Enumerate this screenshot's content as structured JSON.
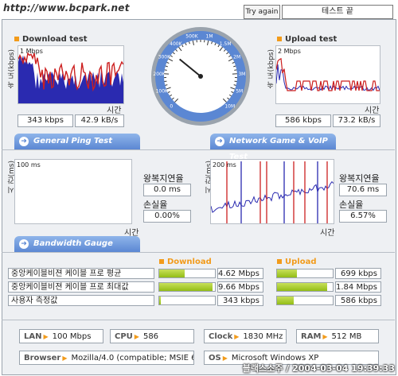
{
  "watermark_url": "http://www.bcpark.net",
  "header": {
    "try_again": "Try again",
    "test_end": "테스트 끝"
  },
  "download": {
    "title": "Download test",
    "ylabel": "속 도(kbps)",
    "scale": "1 Mbps",
    "xlabel": "시간",
    "kbps": "343 kbps",
    "kBs": "42.9 kB/s",
    "line_color": "#cc1f1f",
    "fill_color": "#2a2ab0"
  },
  "upload": {
    "title": "Upload test",
    "ylabel": "속 도(kbps)",
    "scale": "2 Mbps",
    "xlabel": "시간",
    "kbps": "586 kbps",
    "kBs": "73.2 kB/s"
  },
  "gauge": {
    "labels": [
      "0",
      "100K",
      "200K",
      "300K",
      "400K",
      "500K",
      "1M",
      "1.5M",
      "2M",
      "3M",
      "5M",
      "10M"
    ],
    "value_kbps": 343
  },
  "tabs": {
    "ping": "General Ping Test",
    "game": "Network Game & VoIP Test",
    "bandwidth": "Bandwidth Gauge"
  },
  "ping": {
    "ylabel": "시 간(ms)",
    "scale": "100 ms",
    "xlabel": "시간",
    "rtt_label": "왕복지연율",
    "rtt": "0.0 ms",
    "loss_label": "손실율",
    "loss": "0.00%"
  },
  "game": {
    "ylabel": "시 간(ms)",
    "scale": "200 ms",
    "xlabel": "시간",
    "rtt_label": "왕복지연율",
    "rtt": "70.6 ms",
    "loss_label": "손실율",
    "loss": "6.57%"
  },
  "bandwidth": {
    "download_header": "Download",
    "upload_header": "Upload",
    "rows": [
      {
        "label": "중앙케이블비젼 케이블 프로 평균",
        "dl": "4.62 Mbps",
        "dl_frac": 0.45,
        "ul": "699 kbps",
        "ul_frac": 0.35
      },
      {
        "label": "중앙케이블비젼 케이블 프로 최대값",
        "dl": "9.66 Mbps",
        "dl_frac": 0.95,
        "ul": "1.84 Mbps",
        "ul_frac": 0.9
      },
      {
        "label": "사용자 측정값",
        "dl": "343 kbps",
        "dl_frac": 0.03,
        "ul": "586 kbps",
        "ul_frac": 0.3
      }
    ]
  },
  "system": {
    "lan_label": "LAN",
    "lan": "100 Mbps",
    "cpu_label": "CPU",
    "cpu": "586",
    "clock_label": "Clock",
    "clock": "1830 MHz",
    "ram_label": "RAM",
    "ram": "512 MB",
    "browser_label": "Browser",
    "browser": "Mozilla/4.0 (compatible; MSIE 6.0",
    "os_label": "OS",
    "os": "Microsoft Windows XP"
  },
  "footer_stamp": "블랙스소주 / 2004-03-04 19:39:33"
}
